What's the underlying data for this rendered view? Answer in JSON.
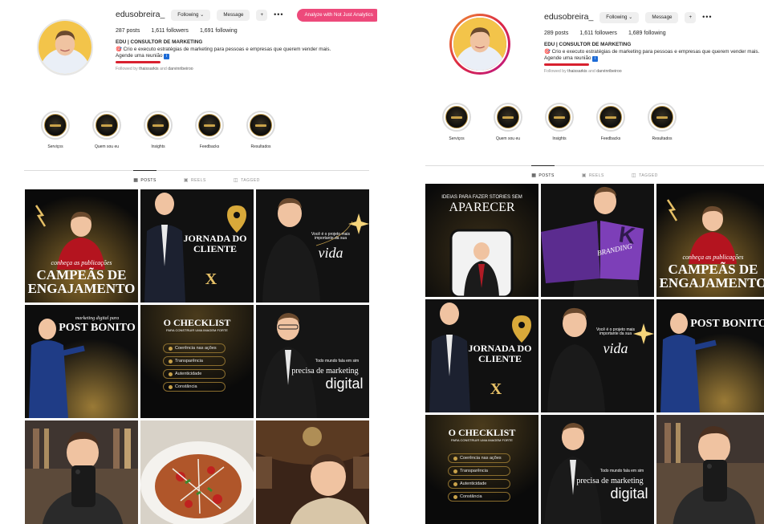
{
  "panels": [
    {
      "id": "left",
      "profile": {
        "username": "edusobreira_",
        "following_label": "Following",
        "message_label": "Message",
        "add_user_label": "+",
        "more_label": "•••",
        "analyze_label": "Analyze with Not Just Analytics",
        "posts": "287 posts",
        "followers": "1,611 followers",
        "following": "1,691 following",
        "bio_name": "EDU | CONSULTOR DE MARKETING",
        "bio_line": "🎯 Crio e executo estratégias de marketing para pessoas e empresas que querem vender mais.",
        "bio_cta": "Agende uma reunião",
        "followed_prefix": "Followed by",
        "followed_names": "thaissarkis",
        "followed_and": "and",
        "followed_names2": "darvinribeiroo"
      },
      "highlights": [
        "Serviços",
        "Quem sou eu",
        "Insights",
        "Feedbacks",
        "Resultados"
      ],
      "tabs": [
        "POSTS",
        "REELS",
        "TAGGED"
      ],
      "posts": [
        {
          "kind": "campeas",
          "line1": "conheça as publicações",
          "line2": "CAMPEÃS DE",
          "line3": "ENGAJAMENTO"
        },
        {
          "kind": "jornada",
          "line1": "JORNADA DO",
          "line2": "CLIENTE",
          "line3": "X"
        },
        {
          "kind": "vida",
          "line1": "Você é o projeto mais importante da sua",
          "line2": "vida"
        },
        {
          "kind": "postbonito",
          "line1": "marketing digital para",
          "line2": "POST BONITO"
        },
        {
          "kind": "checklist",
          "line1": "O CHECKLIST",
          "line2": "PARA CONSTRUIR UMA IMAGEM FORTE",
          "items": [
            "Coerência nas ações",
            "Transparência",
            "Autenticidade",
            "Constância"
          ]
        },
        {
          "kind": "digital",
          "line1": "Todo mundo fala em sim",
          "line2": "precisa de marketing",
          "line3": "digital"
        },
        {
          "kind": "selfie"
        },
        {
          "kind": "food"
        },
        {
          "kind": "theater"
        }
      ]
    },
    {
      "id": "right",
      "profile": {
        "username": "edusobreira_",
        "following_label": "Following",
        "message_label": "Message",
        "add_user_label": "+",
        "more_label": "•••",
        "posts": "289 posts",
        "followers": "1,611 followers",
        "following": "1,689 following",
        "bio_name": "EDU | CONSULTOR DE MARKETING",
        "bio_line": "🎯 Crio e executo estratégias de marketing para pessoas e empresas que querem vender mais.",
        "bio_cta": "Agende uma reunião",
        "followed_prefix": "Followed by",
        "followed_names": "thaissarkis",
        "followed_and": "and",
        "followed_names2": "darvinribeiroo"
      },
      "highlights": [
        "Serviços",
        "Quem sou eu",
        "Insights",
        "Feedbacks",
        "Resultados"
      ],
      "tabs": [
        "POSTS",
        "REELS",
        "TAGGED"
      ],
      "posts": [
        {
          "kind": "stories",
          "line1": "IDEIAS PARA FAZER STORIES SEM",
          "line2": "APARECER"
        },
        {
          "kind": "branding",
          "line1": "BRANDING"
        },
        {
          "kind": "campeas",
          "line1": "conheça as publicações",
          "line2": "CAMPEÃS DE",
          "line3": "ENGAJAMENTO"
        },
        {
          "kind": "jornada",
          "line1": "JORNADA DO",
          "line2": "CLIENTE",
          "line3": "X"
        },
        {
          "kind": "vida",
          "line1": "Você é o projeto mais importante da sua",
          "line2": "vida"
        },
        {
          "kind": "postbonito",
          "line1": "",
          "line2": "POST BONITO"
        },
        {
          "kind": "checklist",
          "line1": "O CHECKLIST",
          "line2": "PARA CONSTRUIR UMA IMAGEM FORTE",
          "items": [
            "Coerência nas ações",
            "Transparência",
            "Autenticidade",
            "Constância"
          ]
        },
        {
          "kind": "digital",
          "line1": "Todo mundo fala em sim",
          "line2": "precisa de marketing",
          "line3": "digital"
        },
        {
          "kind": "selfie"
        }
      ]
    }
  ],
  "colors": {
    "analyze_button": "#ed4a7b",
    "gold": "#e6c066",
    "highlight_ring": "#dbdbdb",
    "story_ring": "#dc2743"
  }
}
